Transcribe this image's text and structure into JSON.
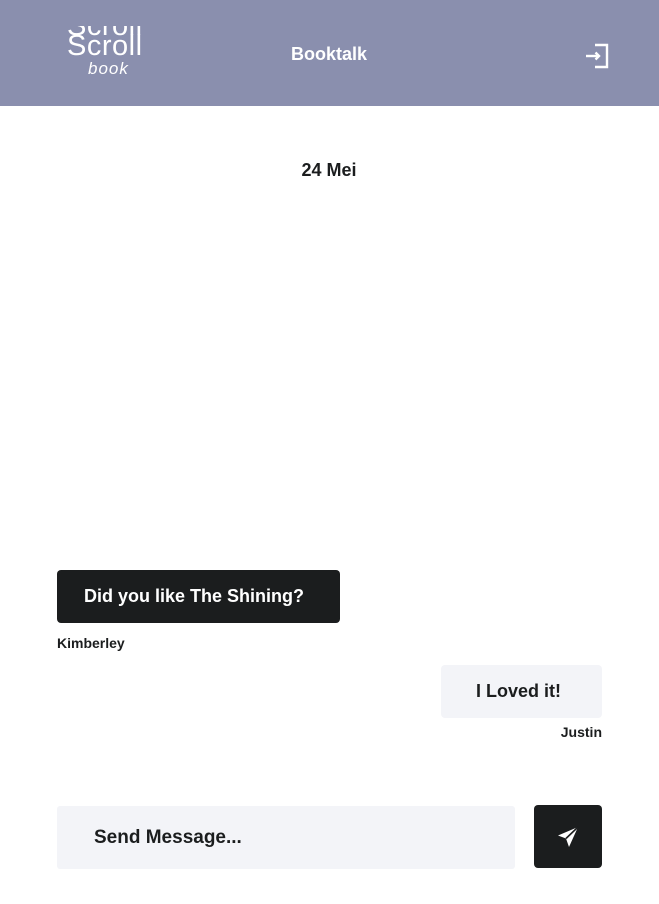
{
  "header": {
    "logo": {
      "line1": "Scroll",
      "line2": "Scroll",
      "line3": "book"
    },
    "title": "Booktalk",
    "logout_icon": "logout-icon"
  },
  "chat": {
    "date": "24 Mei",
    "messages": [
      {
        "text": "Did you like The Shining?",
        "sender": "Kimberley",
        "side": "left"
      },
      {
        "text": "I Loved it!",
        "sender": "Justin",
        "side": "right"
      }
    ]
  },
  "composer": {
    "placeholder": "Send Message...",
    "send_icon": "send-icon"
  },
  "colors": {
    "header_bg": "#8a8fae",
    "dark": "#1b1d1e",
    "light_bubble": "#f3f4f8",
    "white": "#ffffff"
  }
}
